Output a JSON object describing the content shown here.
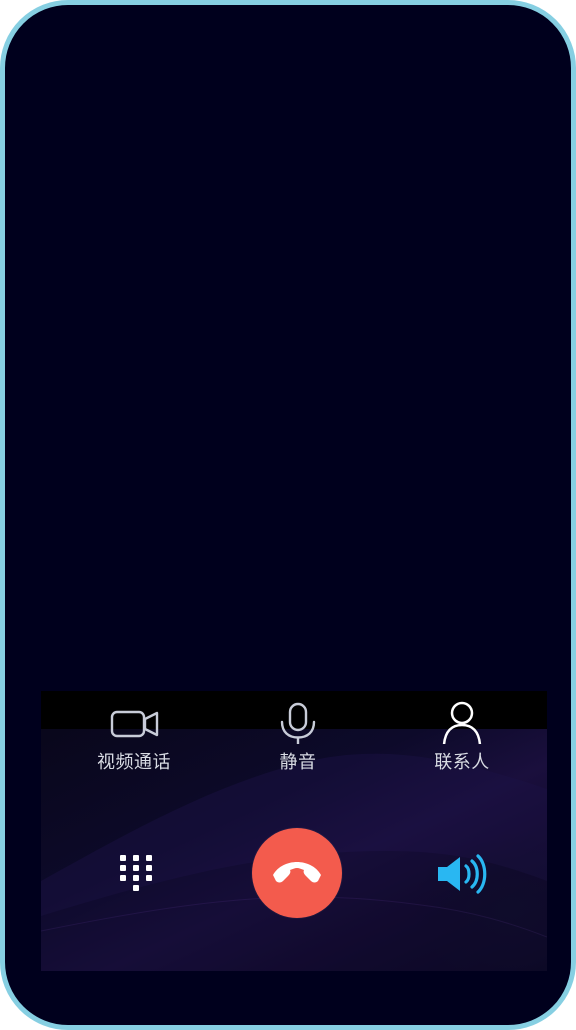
{
  "call_screen": {
    "actions": [
      {
        "label": "视频通话",
        "icon": "video-camera-icon"
      },
      {
        "label": "静音",
        "icon": "microphone-icon"
      },
      {
        "label": "联系人",
        "icon": "contact-icon"
      }
    ],
    "controls": {
      "keypad_icon": "dialpad-icon",
      "end_call_icon": "end-call-icon",
      "speaker_icon": "speaker-icon"
    }
  },
  "colors": {
    "frame_border": "#86CFE2",
    "screen_background": "#00001D",
    "end_call": "#F35B4D",
    "speaker_active": "#29B7F2",
    "action_text": "#D8DBE3"
  }
}
